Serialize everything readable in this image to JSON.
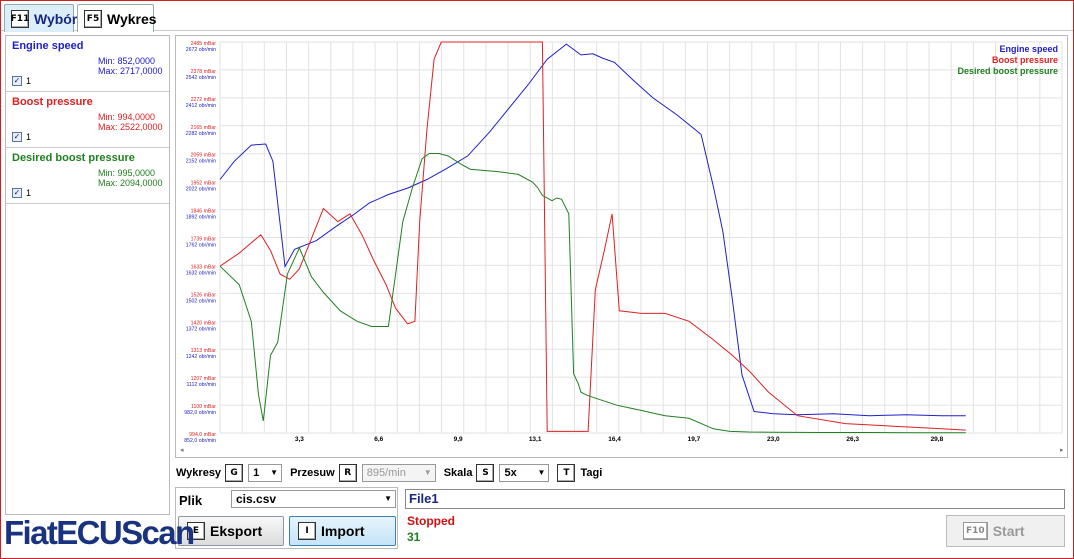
{
  "tabs": [
    {
      "key": "F11",
      "label": "Wybór",
      "active": true
    },
    {
      "key": "F5",
      "label": "Wykres",
      "active": false
    }
  ],
  "params": [
    {
      "name": "Engine speed",
      "min": "Min: 852,0000",
      "max": "Max: 2717,0000",
      "check": "1",
      "color": "#2020c8"
    },
    {
      "name": "Boost pressure",
      "min": "Min: 994,0000",
      "max": "Max: 2522,0000",
      "check": "1",
      "color": "#e02020"
    },
    {
      "name": "Desired boost pressure",
      "min": "Min: 995,0000",
      "max": "Max: 2094,0000",
      "check": "1",
      "color": "#208020"
    }
  ],
  "chart_data": {
    "type": "line",
    "xlim": [
      0,
      35
    ],
    "x_ticks": [
      "3,3",
      "6,6",
      "9,9",
      "13,1",
      "16,4",
      "19,7",
      "23,0",
      "26,3",
      "29,8"
    ],
    "x_tick_values": [
      3.3,
      6.6,
      9.9,
      13.1,
      16.4,
      19.7,
      23.0,
      26.3,
      29.8
    ],
    "y_ticks_mbar": [
      "2485 mBar",
      "2378 mBar",
      "2272 mBar",
      "2165 mBar",
      "2059 mBar",
      "1952 mBar",
      "1846 mBar",
      "1739 mBar",
      "1633 mBar",
      "1526 mBar",
      "1420 mBar",
      "1313 mBar",
      "1207 mBar",
      "1100 mBar",
      "994,0 mBar"
    ],
    "y_ticks_rpm": [
      "2672 obr/min",
      "2542 obr/min",
      "2412 obr/min",
      "2282 obr/min",
      "2152 obr/min",
      "2022 obr/min",
      "1892 obr/min",
      "1762 obr/min",
      "1632 obr/min",
      "1502 obr/min",
      "1372 obr/min",
      "1242 obr/min",
      "1112 obr/min",
      "982,0 obr/min",
      "852,0 obr/min"
    ],
    "ylim_rpm": [
      852,
      2672
    ],
    "ylim_mbar": [
      994,
      2485
    ],
    "legend_position": "top-right",
    "grid": true,
    "series": [
      {
        "name": "Engine speed",
        "color": "#2020c8",
        "unit": "rpm",
        "x": [
          0,
          0.6,
          1.3,
          1.9,
          2.2,
          2.7,
          3.1,
          4.0,
          4.8,
          5.6,
          6.2,
          7.0,
          7.8,
          8.6,
          9.4,
          10.3,
          11.2,
          12.0,
          12.8,
          13.6,
          14.4,
          15.0,
          15.5,
          15.9,
          16.4,
          17.2,
          18.0,
          19.0,
          20.0,
          20.5,
          20.9,
          21.3,
          21.7,
          22.2,
          23.0,
          24.0,
          25.5,
          27.0,
          28.5,
          30.0,
          31.0
        ],
        "y": [
          2032,
          2117,
          2192,
          2197,
          2117,
          1627,
          1707,
          1747,
          1812,
          1872,
          1922,
          1962,
          1992,
          2032,
          2082,
          2142,
          2252,
          2362,
          2472,
          2592,
          2662,
          2612,
          2617,
          2597,
          2577,
          2492,
          2412,
          2332,
          2242,
          2002,
          1792,
          1472,
          1122,
          952,
          942,
          937,
          942,
          932,
          937,
          932,
          932
        ]
      },
      {
        "name": "Boost pressure",
        "color": "#e02020",
        "unit": "mbar",
        "x": [
          0,
          0.8,
          1.7,
          2.1,
          2.5,
          2.9,
          3.3,
          4.3,
          4.9,
          5.4,
          5.9,
          6.4,
          6.9,
          7.3,
          7.8,
          8.1,
          8.3,
          8.6,
          8.9,
          9.2,
          9.6,
          10.2,
          11.0,
          11.8,
          12.5,
          13.0,
          13.2,
          13.4,
          13.6,
          13.8,
          14.1,
          14.4,
          15.0,
          15.3,
          15.6,
          16.0,
          16.3,
          16.6,
          17.5,
          18.5,
          19.5,
          20.5,
          21.3,
          22.0,
          22.8,
          24.0,
          26.0,
          28.0,
          30.0,
          31.0
        ],
        "y": [
          1630,
          1680,
          1750,
          1690,
          1600,
          1580,
          1620,
          1850,
          1800,
          1830,
          1750,
          1650,
          1560,
          1470,
          1410,
          1420,
          1800,
          2150,
          2420,
          2485,
          2485,
          2485,
          2485,
          2485,
          2485,
          2485,
          2485,
          2485,
          1000,
          1000,
          1000,
          1000,
          1000,
          1000,
          1540,
          1700,
          1830,
          1460,
          1450,
          1450,
          1420,
          1350,
          1290,
          1230,
          1150,
          1060,
          1030,
          1020,
          1010,
          1005
        ]
      },
      {
        "name": "Desired boost pressure",
        "color": "#208020",
        "unit": "mbar",
        "x": [
          0,
          0.8,
          1.3,
          1.6,
          1.8,
          2.1,
          2.4,
          2.8,
          3.3,
          3.8,
          4.3,
          5.0,
          5.7,
          6.3,
          7.0,
          7.6,
          8.0,
          8.4,
          8.7,
          9.1,
          9.5,
          10.0,
          10.4,
          11.0,
          11.6,
          12.4,
          13.0,
          13.2,
          13.4,
          13.8,
          14.0,
          14.2,
          14.5,
          14.7,
          14.9,
          15.0,
          15.2,
          15.5,
          16.5,
          17.5,
          18.5,
          19.5,
          20.5,
          21.2,
          22.0,
          23.0,
          25.0,
          27.0,
          29.0,
          30.0,
          31.0
        ],
        "y": [
          1630,
          1560,
          1420,
          1140,
          1040,
          1290,
          1340,
          1600,
          1700,
          1590,
          1530,
          1460,
          1420,
          1400,
          1400,
          1800,
          1930,
          2040,
          2060,
          2060,
          2050,
          2020,
          2000,
          1995,
          1990,
          1980,
          1950,
          1930,
          1900,
          1880,
          1890,
          1885,
          1830,
          1220,
          1180,
          1150,
          1140,
          1130,
          1100,
          1080,
          1060,
          1050,
          1010,
          1000,
          998,
          997,
          996,
          996,
          995,
          995,
          995
        ]
      }
    ]
  },
  "controls": {
    "wykresy_label": "Wykresy",
    "wykresy_key": "G",
    "wykresy_value": "1",
    "przesuw_label": "Przesuw",
    "przesuw_key": "R",
    "przesuw_value": "895/min",
    "skala_label": "Skala",
    "skala_key": "S",
    "skala_value": "5x",
    "tagi_key": "T",
    "tagi_label": "Tagi"
  },
  "file": {
    "plik_label": "Plik",
    "plik_value": "cis.csv",
    "eksport_key": "E",
    "eksport_label": "Eksport",
    "import_key": "I",
    "import_label": "Import",
    "name": "File1"
  },
  "status": {
    "state": "Stopped",
    "count": "31",
    "start_key": "F10",
    "start_label": "Start"
  },
  "logo": "FiatECUScan",
  "colors": {
    "rpm": "#2020c8",
    "mbar": "#e02020",
    "desired": "#208020",
    "frame": "#d02020",
    "tab_active": "#dbeefa"
  }
}
